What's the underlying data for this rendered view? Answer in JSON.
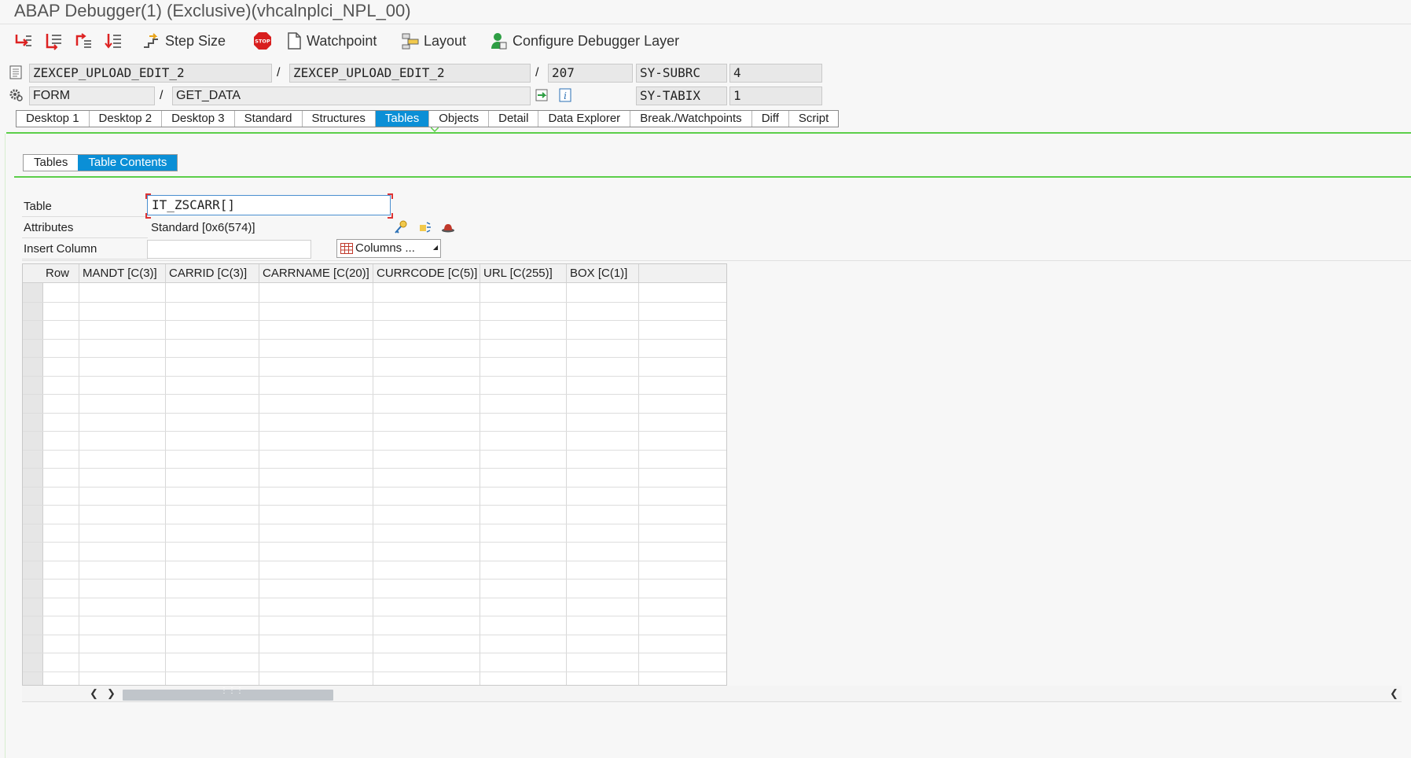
{
  "window": {
    "title": "ABAP Debugger(1)  (Exclusive)(vhcalnplci_NPL_00)"
  },
  "toolbar": {
    "step_size_label": "Step Size",
    "watchpoint_label": "Watchpoint",
    "layout_label": "Layout",
    "configure_label": "Configure Debugger Layer",
    "stop_text": "STOP"
  },
  "info": {
    "program": "ZEXCEP_UPLOAD_EDIT_2",
    "include": "ZEXCEP_UPLOAD_EDIT_2",
    "line": "207",
    "type": "FORM",
    "event": "GET_DATA",
    "sep": "/",
    "sysvar1_name": "SY-SUBRC",
    "sysvar1_value": "4",
    "sysvar2_name": "SY-TABIX",
    "sysvar2_value": "1"
  },
  "main_tabs": [
    {
      "label": "Desktop 1",
      "active": false
    },
    {
      "label": "Desktop 2",
      "active": false
    },
    {
      "label": "Desktop 3",
      "active": false
    },
    {
      "label": "Standard",
      "active": false
    },
    {
      "label": "Structures",
      "active": false
    },
    {
      "label": "Tables",
      "active": true
    },
    {
      "label": "Objects",
      "active": false
    },
    {
      "label": "Detail",
      "active": false
    },
    {
      "label": "Data Explorer",
      "active": false
    },
    {
      "label": "Break./Watchpoints",
      "active": false
    },
    {
      "label": "Diff",
      "active": false
    },
    {
      "label": "Script",
      "active": false
    }
  ],
  "sub_tabs": [
    {
      "label": "Tables",
      "active": false
    },
    {
      "label": "Table Contents",
      "active": true
    }
  ],
  "form": {
    "table_label": "Table",
    "table_value": "IT_ZSCARR[]",
    "attributes_label": "Attributes",
    "attributes_value": "Standard [0x6(574)]",
    "insert_column_label": "Insert Column",
    "insert_column_value": "",
    "columns_button": "Columns ..."
  },
  "grid": {
    "headers": [
      "Row",
      "MANDT [C(3)]",
      "CARRID [C(3)]",
      "CARRNAME [C(20)]",
      "CURRCODE [C(5)]",
      "URL [C(255)]",
      "BOX [C(1)]"
    ],
    "rows": []
  },
  "colors": {
    "accent": "#0b8fd6",
    "green_rule": "#5ccf4a"
  }
}
